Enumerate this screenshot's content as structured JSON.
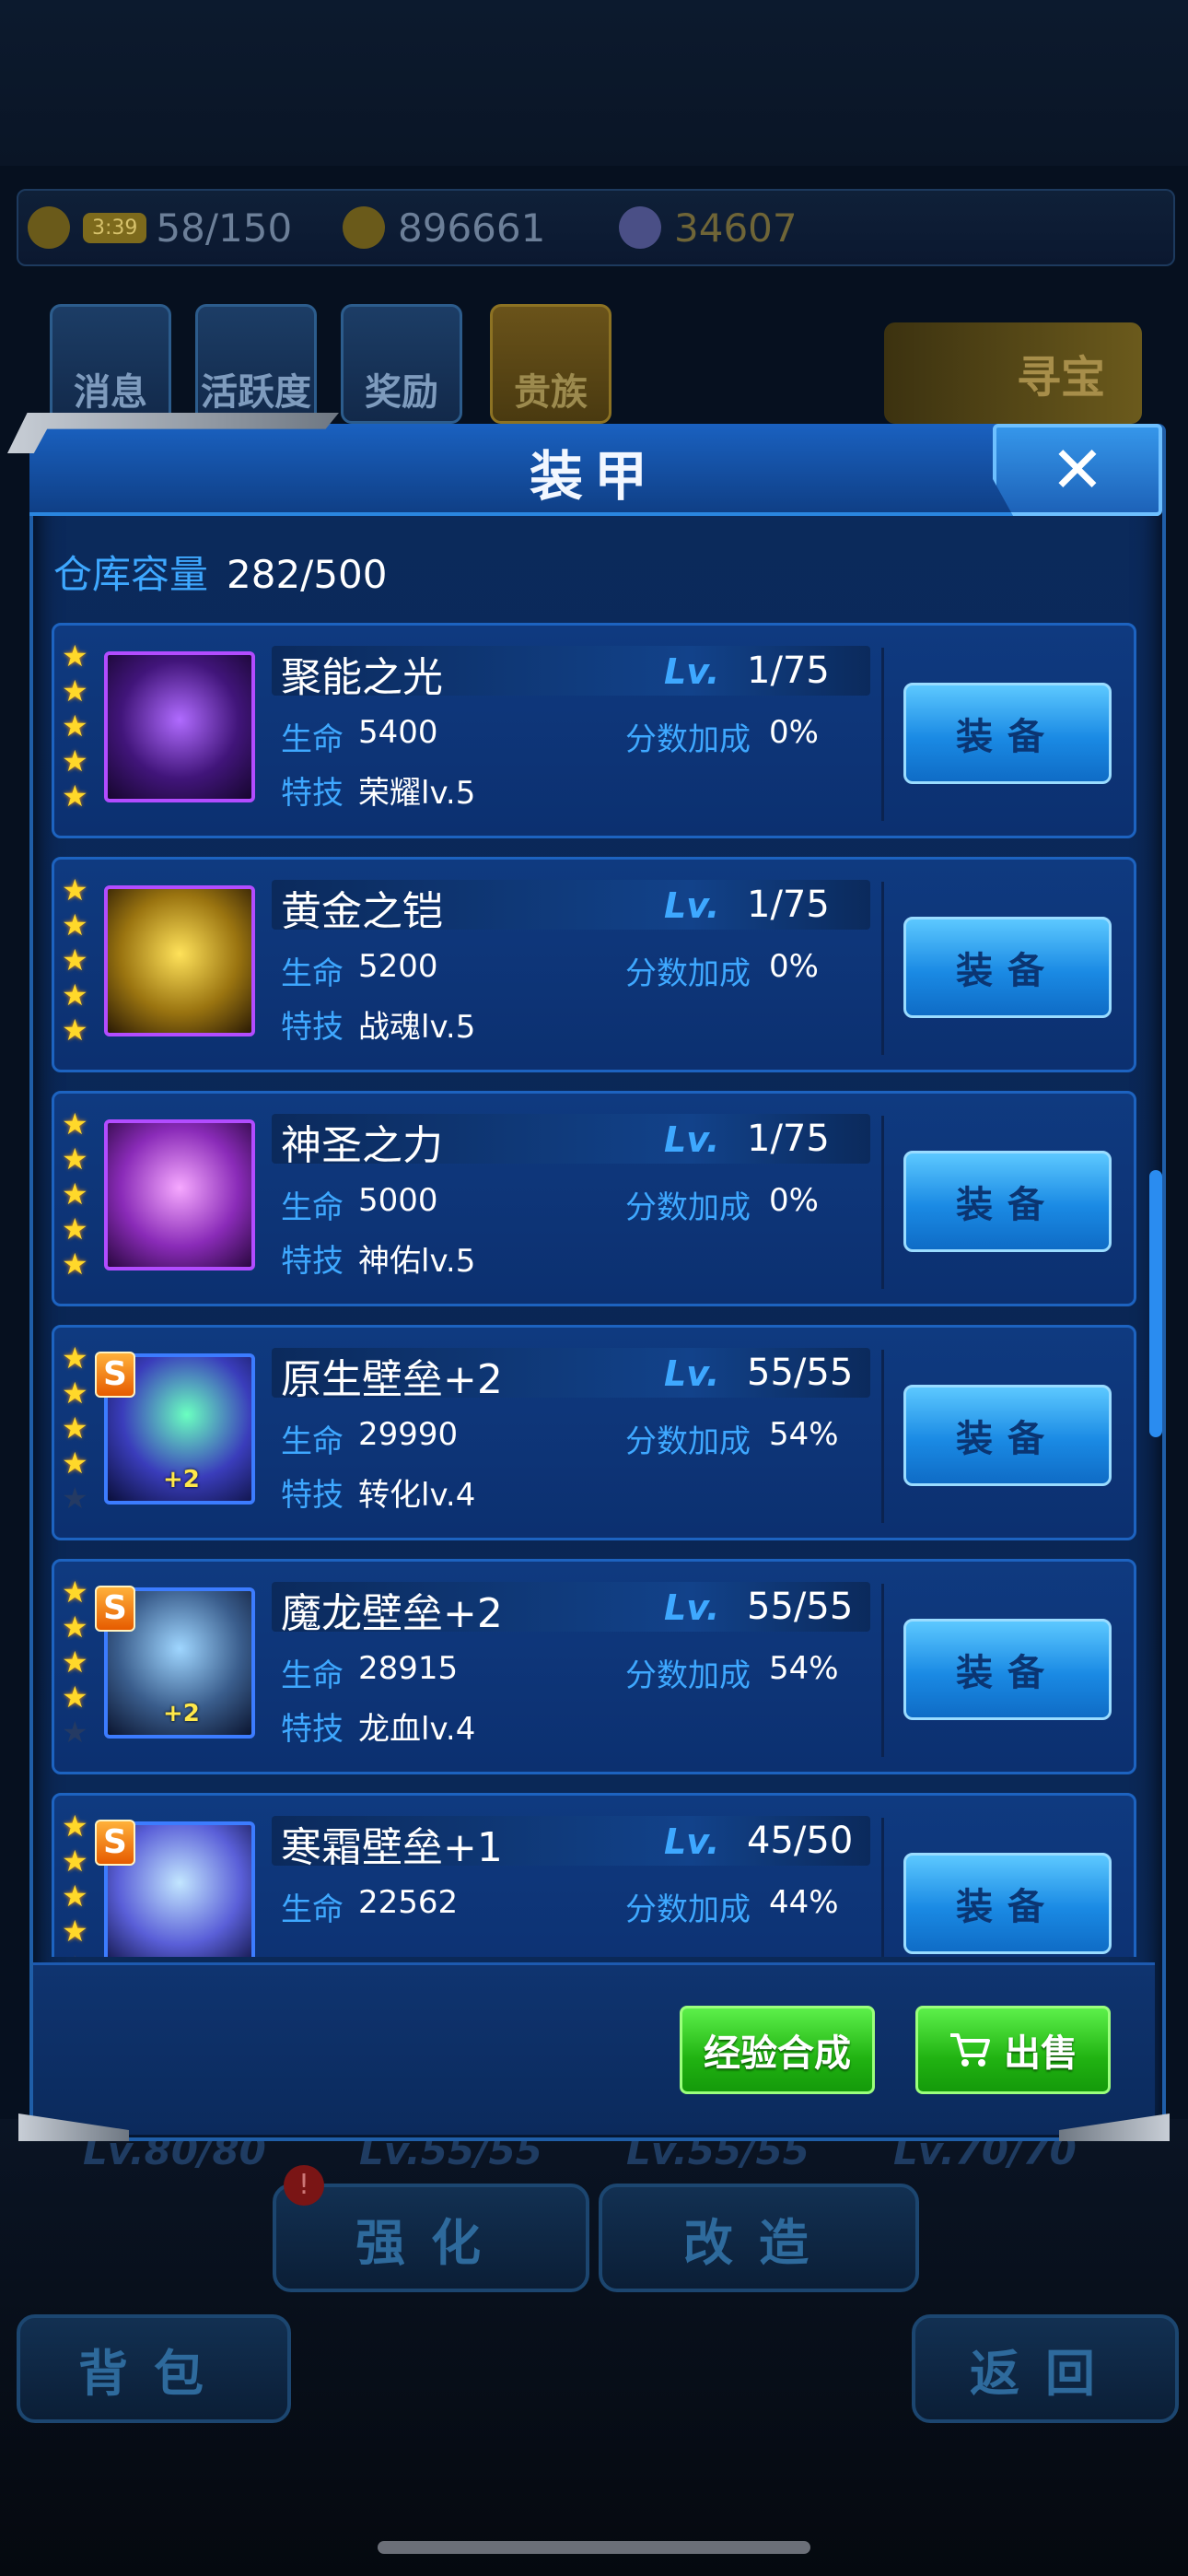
{
  "resources": {
    "timer": "3:39",
    "energy": "58/150",
    "gold": "896661",
    "diamonds": "34607"
  },
  "top_nav": [
    "消息",
    "活跃度",
    "奖励",
    "贵族"
  ],
  "treasure_label": "寻宝",
  "dialog": {
    "title": "装甲",
    "close_symbol": "✕",
    "capacity_label": "仓库容量",
    "capacity_value": "282/500",
    "lv_label": "Lv.",
    "hp_label": "生命",
    "bonus_label": "分数加成",
    "skill_label": "特技",
    "equip_label": "装备",
    "items": [
      {
        "name": "聚能之光",
        "level": "1/75",
        "hp": "5400",
        "bonus": "0%",
        "skill": "荣耀lv.5",
        "stars": 5,
        "s_rank": false,
        "plus": ""
      },
      {
        "name": "黄金之铠",
        "level": "1/75",
        "hp": "5200",
        "bonus": "0%",
        "skill": "战魂lv.5",
        "stars": 5,
        "s_rank": false,
        "plus": ""
      },
      {
        "name": "神圣之力",
        "level": "1/75",
        "hp": "5000",
        "bonus": "0%",
        "skill": "神佑lv.5",
        "stars": 5,
        "s_rank": false,
        "plus": ""
      },
      {
        "name": "原生壁垒+2",
        "level": "55/55",
        "hp": "29990",
        "bonus": "54%",
        "skill": "转化lv.4",
        "stars": 4,
        "s_rank": true,
        "plus": "+2"
      },
      {
        "name": "魔龙壁垒+2",
        "level": "55/55",
        "hp": "28915",
        "bonus": "54%",
        "skill": "龙血lv.4",
        "stars": 4,
        "s_rank": true,
        "plus": "+2"
      },
      {
        "name": "寒霜壁垒+1",
        "level": "45/50",
        "hp": "22562",
        "bonus": "44%",
        "skill": "",
        "stars": 4,
        "s_rank": true,
        "plus": ""
      }
    ],
    "footer": {
      "merge_label": "经验合成",
      "sell_label": "出售"
    }
  },
  "bottom_nav": {
    "upgrade": "强化",
    "forge": "改造",
    "bag": "背包",
    "back": "返回",
    "badge": "!",
    "ghost_levels": [
      "Lv.80/80",
      "Lv.55/55",
      "Lv.55/55",
      "Lv.70/70"
    ]
  },
  "colors": {
    "accent_blue": "#3ea8ff",
    "star_gold": "#ffd82a",
    "button_green": "#21b312",
    "dialog_bg": "#0b2a5c"
  }
}
